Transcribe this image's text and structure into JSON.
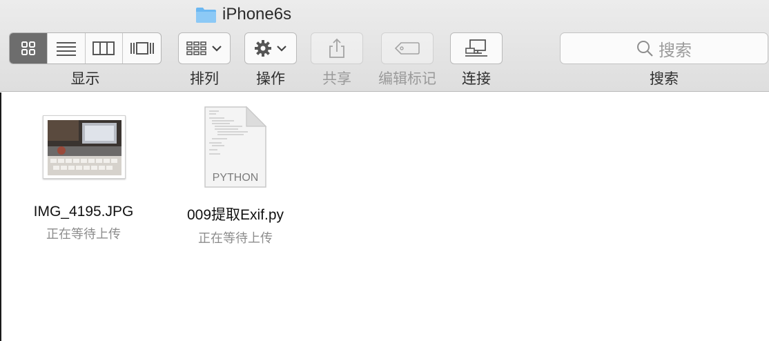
{
  "window": {
    "title": "iPhone6s"
  },
  "toolbar": {
    "view_label": "显示",
    "arrange_label": "排列",
    "action_label": "操作",
    "share_label": "共享",
    "tags_label": "编辑标记",
    "connect_label": "连接",
    "search_label": "搜索",
    "search_placeholder": "搜索"
  },
  "files": [
    {
      "name": "IMG_4195.JPG",
      "status": "正在等待上传",
      "kind": "image"
    },
    {
      "name": "009提取Exif.py",
      "status": "正在等待上传",
      "kind": "document",
      "type_label": "PYTHON"
    }
  ],
  "colors": {
    "folder": "#6bb8f2",
    "active_segment": "#6d6d6d"
  }
}
